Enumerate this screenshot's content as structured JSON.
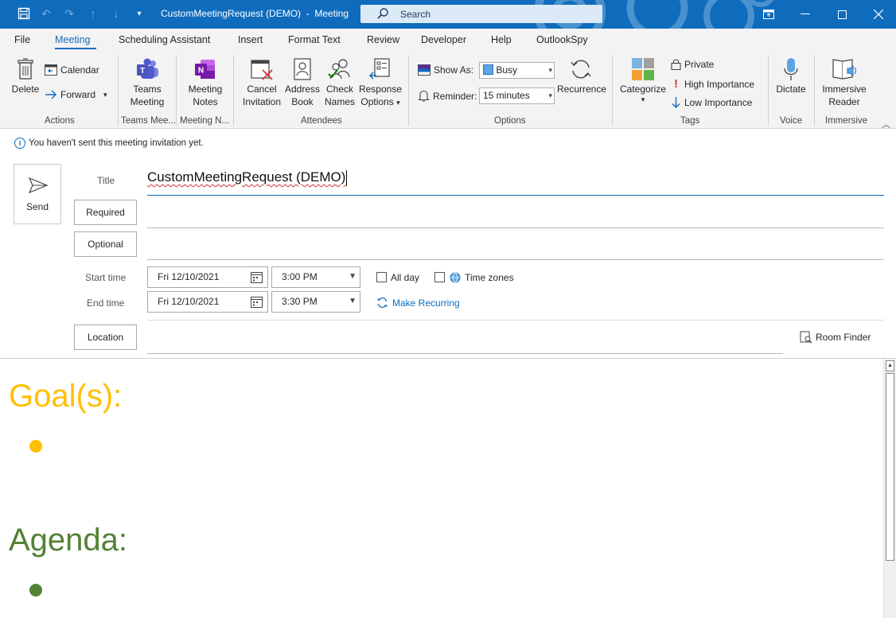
{
  "titlebar": {
    "title": "CustomMeetingRequest (DEMO)  -  Meeting",
    "search_placeholder": "Search"
  },
  "tabs": [
    {
      "label": "File"
    },
    {
      "label": "Meeting"
    },
    {
      "label": "Scheduling Assistant"
    },
    {
      "label": "Insert"
    },
    {
      "label": "Format Text"
    },
    {
      "label": "Review"
    },
    {
      "label": "Developer"
    },
    {
      "label": "Help"
    },
    {
      "label": "OutlookSpy"
    }
  ],
  "ribbon": {
    "actions": {
      "delete": "Delete",
      "calendar": "Calendar",
      "forward": "Forward",
      "group": "Actions"
    },
    "teams": {
      "line1": "Teams",
      "line2": "Meeting",
      "group": "Teams Mee..."
    },
    "notes": {
      "line1": "Meeting",
      "line2": "Notes",
      "group": "Meeting N..."
    },
    "attendees": {
      "cancel1": "Cancel",
      "cancel2": "Invitation",
      "address1": "Address",
      "address2": "Book",
      "check1": "Check",
      "check2": "Names",
      "response1": "Response",
      "response2": "Options",
      "group": "Attendees"
    },
    "options": {
      "show_as_label": "Show As:",
      "show_as_value": "Busy",
      "reminder_label": "Reminder:",
      "reminder_value": "15 minutes",
      "recurrence": "Recurrence",
      "group": "Options"
    },
    "tags": {
      "categorize": "Categorize",
      "private": "Private",
      "high": "High Importance",
      "low": "Low Importance",
      "group": "Tags"
    },
    "voice": {
      "dictate": "Dictate",
      "group": "Voice"
    },
    "immersive": {
      "line1": "Immersive",
      "line2": "Reader",
      "group": "Immersive"
    }
  },
  "infobar": {
    "message": "You haven't sent this meeting invitation yet."
  },
  "form": {
    "send": "Send",
    "title_label": "Title",
    "title_value": "CustomMeetingRequest (DEMO)",
    "required": "Required",
    "optional": "Optional",
    "start_label": "Start time",
    "end_label": "End time",
    "start_date": "Fri 12/10/2021",
    "start_time": "3:00 PM",
    "end_date": "Fri 12/10/2021",
    "end_time": "3:30 PM",
    "all_day": "All day",
    "time_zones": "Time zones",
    "make_recurring": "Make Recurring",
    "location": "Location",
    "room_finder": "Room Finder"
  },
  "body": {
    "goal_heading": "Goal(s):",
    "agenda_heading": "Agenda:"
  },
  "colors": {
    "accent": "#0f6cbd",
    "goal": "#ffc000",
    "agenda": "#538135"
  }
}
